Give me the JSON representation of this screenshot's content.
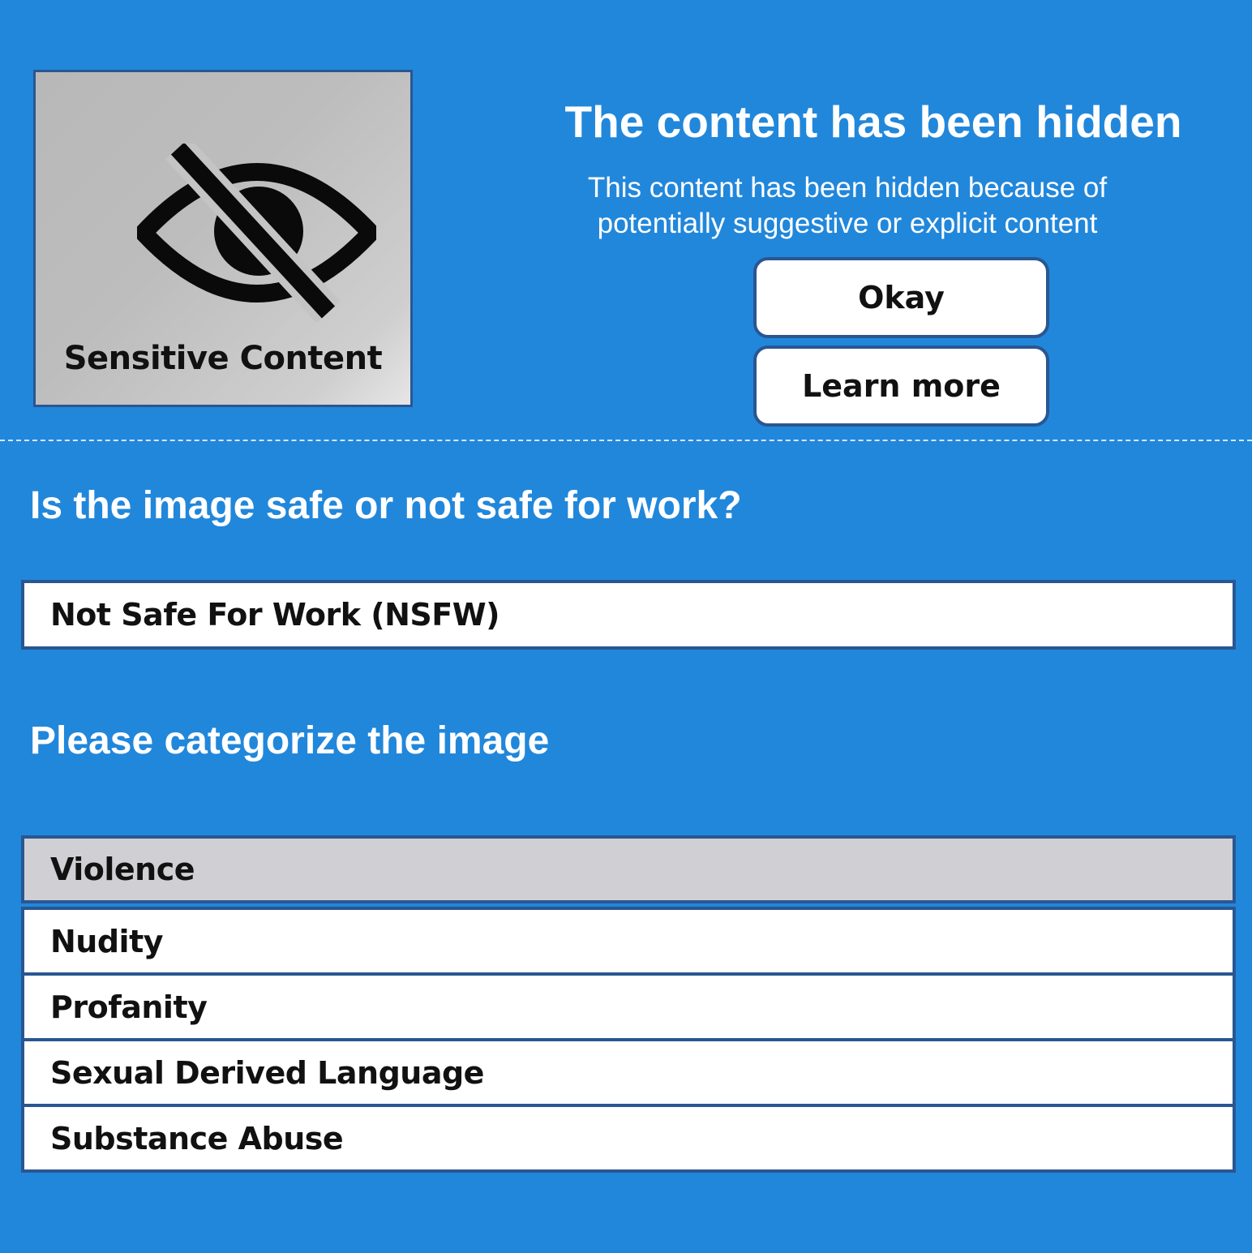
{
  "thumbnail": {
    "icon": "eye-slash-icon",
    "label": "Sensitive Content"
  },
  "notice": {
    "title": "The content has been hidden",
    "body_line1": "This content has been hidden because of",
    "body_line2": "potentially suggestive or explicit content",
    "okay_label": "Okay",
    "learn_more_label": "Learn more"
  },
  "safety": {
    "question": "Is the image safe or not safe for work?",
    "answer": "Not Safe For Work (NSFW)"
  },
  "categorize": {
    "title": "Please categorize the image",
    "selected": "Violence",
    "options": [
      {
        "label": "Violence"
      },
      {
        "label": "Nudity"
      },
      {
        "label": "Profanity"
      },
      {
        "label": "Sexual Derived Language"
      },
      {
        "label": "Substance Abuse"
      }
    ]
  },
  "colors": {
    "background": "#2187DB",
    "border": "#2A5692",
    "selected_row": "#D0CFD3"
  }
}
